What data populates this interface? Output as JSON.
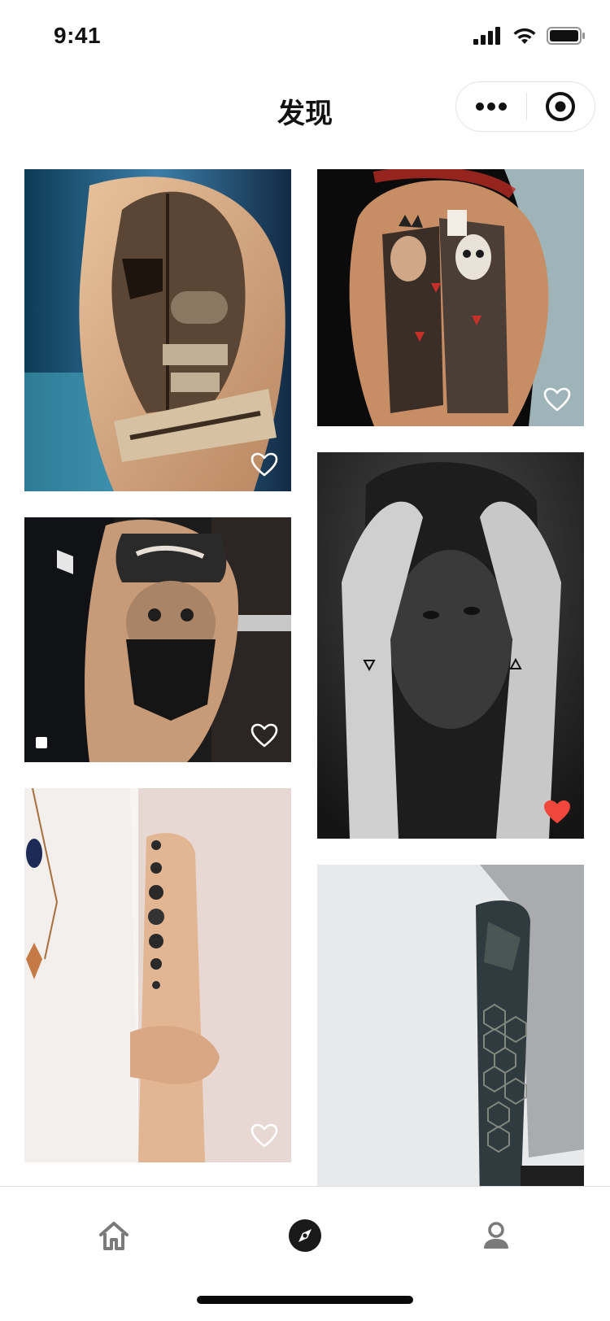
{
  "status_bar": {
    "time": "9:41",
    "icons": [
      "signal-icon",
      "wifi-icon",
      "battery-icon"
    ]
  },
  "nav": {
    "title": "发现",
    "capsule": {
      "more_icon": "more-dots-icon",
      "close_icon": "target-icon"
    }
  },
  "feed": {
    "left_column": [
      {
        "subject": "spartan-helmet-police-badge-arm-tattoo",
        "liked": false
      },
      {
        "subject": "bandana-girl-portrait-arm-tattoo",
        "liked": false
      },
      {
        "subject": "moon-phases-forearm-tattoo",
        "liked": false
      }
    ],
    "right_column": [
      {
        "subject": "queen-and-skull-king-card-arm-tattoo",
        "liked": false
      },
      {
        "subject": "triangle-wrist-tattoos-black-and-white",
        "liked": true
      },
      {
        "subject": "geometric-hexagon-sleeve-tattoo",
        "liked": false
      }
    ]
  },
  "tab_bar": {
    "items": [
      {
        "icon": "home-icon",
        "active": false
      },
      {
        "icon": "compass-icon",
        "active": true
      },
      {
        "icon": "user-icon",
        "active": false
      }
    ]
  },
  "colors": {
    "like_active": "#f0463c",
    "like_inactive": "#ffffff",
    "tab_inactive": "#7a7a7a",
    "tab_active": "#1a1a1a"
  }
}
